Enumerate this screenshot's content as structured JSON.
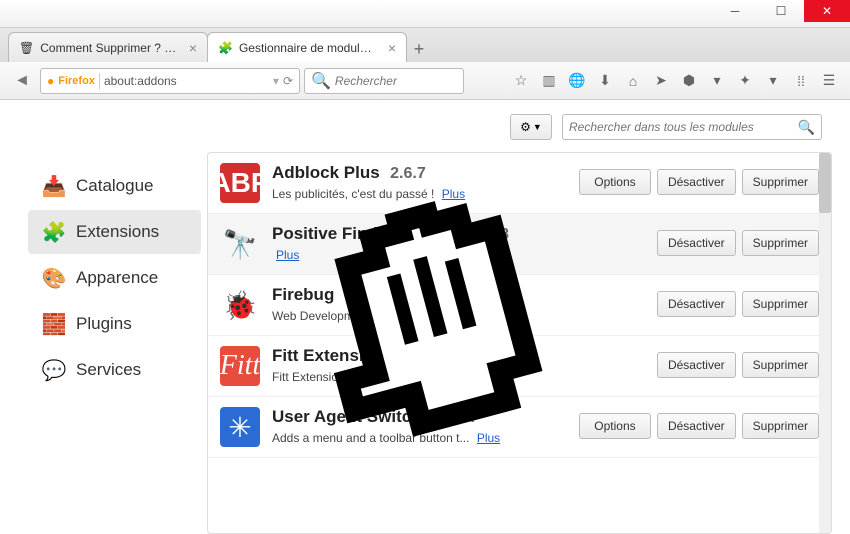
{
  "tabs": [
    {
      "title": "Comment Supprimer ? Net...",
      "favicon": "🗑"
    },
    {
      "title": "Gestionnaire de modules c...",
      "favicon": "🧩"
    }
  ],
  "url": {
    "identity": "Firefox",
    "address": "about:addons"
  },
  "nav_search_placeholder": "Rechercher",
  "sidebar": {
    "items": [
      {
        "label": "Catalogue",
        "icon": "📥"
      },
      {
        "label": "Extensions",
        "icon": "🧩"
      },
      {
        "label": "Apparence",
        "icon": "🎨"
      },
      {
        "label": "Plugins",
        "icon": "🧱"
      },
      {
        "label": "Services",
        "icon": "💬"
      }
    ]
  },
  "addon_search_placeholder": "Rechercher dans tous les modules",
  "buttons": {
    "options": "Options",
    "disable": "Désactiver",
    "remove": "Supprimer",
    "more": "Plus"
  },
  "addons": [
    {
      "name": "Adblock Plus",
      "version": "2.6.7",
      "desc": "Les publicités, c'est du passé !",
      "has_options": true,
      "has_more": true
    },
    {
      "name": "Positive Finds",
      "version": "2.0.5455.24478",
      "desc": "",
      "has_options": false,
      "has_more": true
    },
    {
      "name": "Firebug",
      "version": "",
      "desc": "Web Development",
      "has_options": false,
      "has_more": false
    },
    {
      "name": "Fitt Extension",
      "version": "",
      "desc": "Fitt Extension fo",
      "has_options": false,
      "has_more": false
    },
    {
      "name": "User Agent Switcher",
      "version": "0.7.",
      "desc": "Adds a menu and a toolbar button t...",
      "has_options": true,
      "has_more": true
    }
  ]
}
